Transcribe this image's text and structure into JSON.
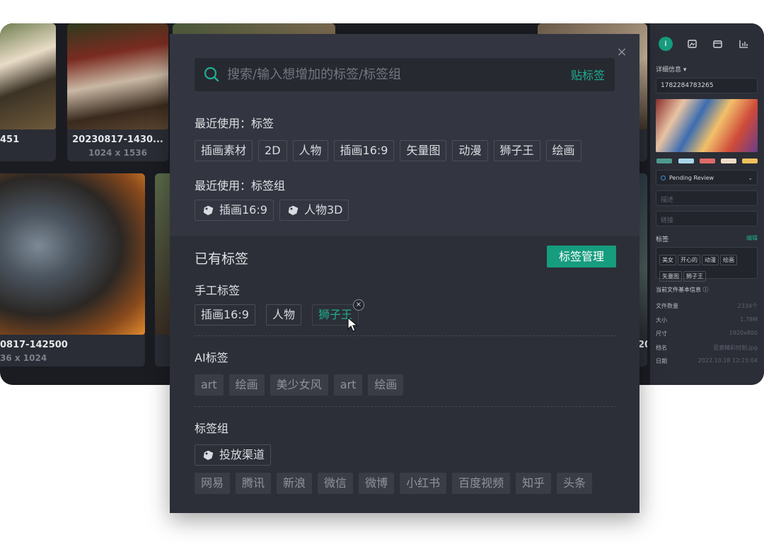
{
  "gallery": {
    "cards": [
      {
        "title": "451",
        "size": ""
      },
      {
        "title": "20230817-1430...",
        "size": "1024 x 1536"
      },
      {
        "title": "0817-142500",
        "size": "36 x 1024"
      },
      {
        "title": "20",
        "size": ""
      }
    ]
  },
  "detail_panel": {
    "section_title": "详细信息 ▾",
    "id_value": "1782284783265",
    "swatches": [
      "#4f9b8f",
      "#a9d6ec",
      "#e06a6a",
      "#f2dcc6",
      "#f0c05c"
    ],
    "status": "Pending Review",
    "description_placeholder": "描述",
    "link_placeholder": "链接",
    "tags_title": "标签",
    "tags_edit": "编辑",
    "tags": [
      "美女",
      "开心的",
      "动漫",
      "绘画",
      "矢量图",
      "狮子王"
    ],
    "file_info_title": "当前文件基本信息 ⓘ",
    "file_info": [
      {
        "key": "文件数量",
        "value": "2334个"
      },
      {
        "key": "大小",
        "value": "1.78M"
      },
      {
        "key": "尺寸",
        "value": "1920x800"
      },
      {
        "key": "档名",
        "value": "亚索精彩时刻.jpg"
      },
      {
        "key": "日期",
        "value": "2022.10.18 12:23:04"
      }
    ]
  },
  "modal": {
    "close_icon": "×",
    "search": {
      "placeholder": "搜索/输入想增加的标签/标签组",
      "value": "",
      "submit_label": "贴标签"
    },
    "recent_tags": {
      "label": "最近使用：标签",
      "items": [
        "插画素材",
        "2D",
        "人物",
        "插画16:9",
        "矢量图",
        "动漫",
        "狮子王",
        "绘画"
      ]
    },
    "recent_groups": {
      "label": "最近使用：标签组",
      "items": [
        "插画16:9",
        "人物3D"
      ]
    },
    "existing": {
      "title": "已有标签",
      "manage_label": "标签管理",
      "manual": {
        "label": "手工标签",
        "items": [
          "插画16:9",
          "人物",
          "狮子王"
        ],
        "close_glyph": "×"
      },
      "ai": {
        "label": "AI标签",
        "items": [
          "art",
          "绘画",
          "美少女风",
          "art",
          "绘画"
        ]
      },
      "groups": {
        "label": "标签组",
        "group_name": "投放渠道",
        "items": [
          "网易",
          "腾讯",
          "新浪",
          "微信",
          "微博",
          "小红书",
          "百度视频",
          "知乎",
          "头条"
        ]
      }
    }
  }
}
